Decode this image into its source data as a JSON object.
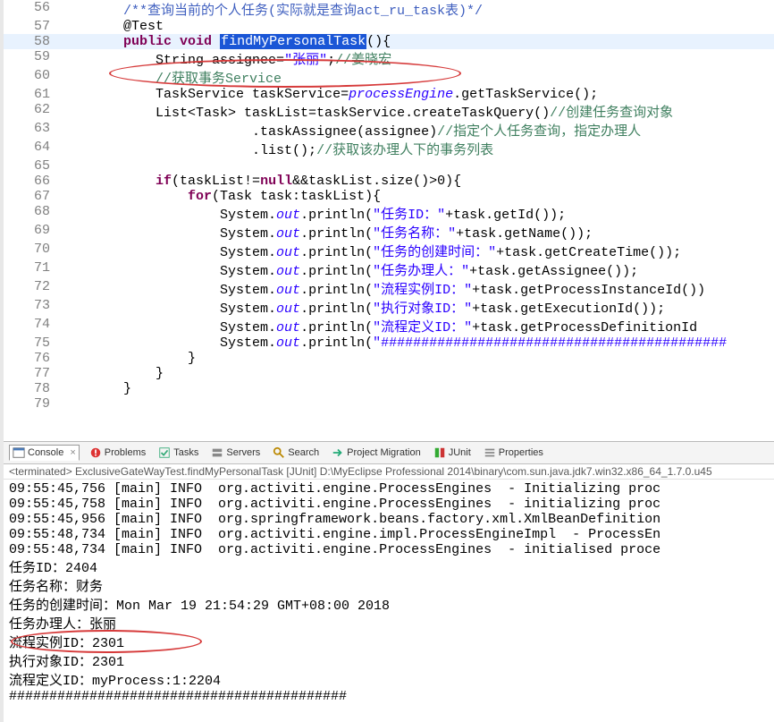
{
  "editor": {
    "lines": [
      {
        "n": 56,
        "segs": [
          {
            "c": "dc",
            "t": "/**查询当前的个人任务(实际就是查询act_ru_task表)*/"
          }
        ],
        "ind": 8
      },
      {
        "n": 57,
        "segs": [
          {
            "t": "@Test"
          }
        ],
        "ind": 8
      },
      {
        "n": 58,
        "segs": [
          {
            "c": "kw",
            "t": "public void"
          },
          {
            "t": " "
          },
          {
            "c": "sel",
            "t": "findMyPersonalTask"
          },
          {
            "t": "(){"
          }
        ],
        "ind": 8,
        "hl": true
      },
      {
        "n": 59,
        "segs": [
          {
            "t": "String assignee="
          },
          {
            "c": "str",
            "t": "\"张丽\""
          },
          {
            "t": ";"
          },
          {
            "c": "cm",
            "t": "//姜晓宏"
          }
        ],
        "ind": 12
      },
      {
        "n": 60,
        "segs": [
          {
            "c": "cm",
            "t": "//获取事务Service"
          }
        ],
        "ind": 12
      },
      {
        "n": 61,
        "segs": [
          {
            "t": "TaskService taskService="
          },
          {
            "c": "it",
            "t": "processEngine"
          },
          {
            "t": ".getTaskService();"
          }
        ],
        "ind": 12
      },
      {
        "n": 62,
        "segs": [
          {
            "t": "List<Task> taskList=taskService.createTaskQuery()"
          },
          {
            "c": "cm",
            "t": "//创建任务查询对象"
          }
        ],
        "ind": 12
      },
      {
        "n": 63,
        "segs": [
          {
            "t": ".taskAssignee(assignee)"
          },
          {
            "c": "cm",
            "t": "//指定个人任务查询，指定办理人"
          }
        ],
        "ind": 24
      },
      {
        "n": 64,
        "segs": [
          {
            "t": ".list();"
          },
          {
            "c": "cm",
            "t": "//获取该办理人下的事务列表"
          }
        ],
        "ind": 24
      },
      {
        "n": 65,
        "segs": [
          {
            "t": ""
          }
        ],
        "ind": 12
      },
      {
        "n": 66,
        "segs": [
          {
            "c": "kw",
            "t": "if"
          },
          {
            "t": "(taskList!="
          },
          {
            "c": "kw",
            "t": "null"
          },
          {
            "t": "&&taskList.size()>0){"
          }
        ],
        "ind": 12
      },
      {
        "n": 67,
        "segs": [
          {
            "c": "kw",
            "t": "for"
          },
          {
            "t": "(Task task:taskList){"
          }
        ],
        "ind": 16
      },
      {
        "n": 68,
        "segs": [
          {
            "t": "System."
          },
          {
            "c": "it",
            "t": "out"
          },
          {
            "t": ".println("
          },
          {
            "c": "str",
            "t": "\"任务ID："
          },
          {
            "c": "str",
            "t": "\""
          },
          {
            "t": "+task.getId());"
          }
        ],
        "ind": 20
      },
      {
        "n": 69,
        "segs": [
          {
            "t": "System."
          },
          {
            "c": "it",
            "t": "out"
          },
          {
            "t": ".println("
          },
          {
            "c": "str",
            "t": "\"任务名称："
          },
          {
            "c": "str",
            "t": "\""
          },
          {
            "t": "+task.getName());"
          }
        ],
        "ind": 20
      },
      {
        "n": 70,
        "segs": [
          {
            "t": "System."
          },
          {
            "c": "it",
            "t": "out"
          },
          {
            "t": ".println("
          },
          {
            "c": "str",
            "t": "\"任务的创建时间："
          },
          {
            "c": "str",
            "t": "\""
          },
          {
            "t": "+task.getCreateTime());"
          }
        ],
        "ind": 20
      },
      {
        "n": 71,
        "segs": [
          {
            "t": "System."
          },
          {
            "c": "it",
            "t": "out"
          },
          {
            "t": ".println("
          },
          {
            "c": "str",
            "t": "\"任务办理人："
          },
          {
            "c": "str",
            "t": "\""
          },
          {
            "t": "+task.getAssignee());"
          }
        ],
        "ind": 20
      },
      {
        "n": 72,
        "segs": [
          {
            "t": "System."
          },
          {
            "c": "it",
            "t": "out"
          },
          {
            "t": ".println("
          },
          {
            "c": "str",
            "t": "\"流程实例ID："
          },
          {
            "c": "str",
            "t": "\""
          },
          {
            "t": "+task.getProcessInstanceId())"
          }
        ],
        "ind": 20
      },
      {
        "n": 73,
        "segs": [
          {
            "t": "System."
          },
          {
            "c": "it",
            "t": "out"
          },
          {
            "t": ".println("
          },
          {
            "c": "str",
            "t": "\"执行对象ID："
          },
          {
            "c": "str",
            "t": "\""
          },
          {
            "t": "+task.getExecutionId());"
          }
        ],
        "ind": 20
      },
      {
        "n": 74,
        "segs": [
          {
            "t": "System."
          },
          {
            "c": "it",
            "t": "out"
          },
          {
            "t": ".println("
          },
          {
            "c": "str",
            "t": "\"流程定义ID："
          },
          {
            "c": "str",
            "t": "\""
          },
          {
            "t": "+task.getProcessDefinitionId"
          }
        ],
        "ind": 20
      },
      {
        "n": 75,
        "segs": [
          {
            "t": "System."
          },
          {
            "c": "it",
            "t": "out"
          },
          {
            "t": ".println("
          },
          {
            "c": "str",
            "t": "\"###########################################"
          }
        ],
        "ind": 20
      },
      {
        "n": 76,
        "segs": [
          {
            "t": "}"
          }
        ],
        "ind": 16
      },
      {
        "n": 77,
        "segs": [
          {
            "t": "}"
          }
        ],
        "ind": 12
      },
      {
        "n": 78,
        "segs": [
          {
            "t": "}"
          }
        ],
        "ind": 8
      },
      {
        "n": 79,
        "segs": [
          {
            "t": ""
          }
        ],
        "ind": 0
      }
    ]
  },
  "views": {
    "tabs": [
      {
        "icon": "console-icon",
        "label": "Console",
        "sel": true
      },
      {
        "icon": "problems-icon",
        "label": "Problems"
      },
      {
        "icon": "tasks-icon",
        "label": "Tasks"
      },
      {
        "icon": "servers-icon",
        "label": "Servers"
      },
      {
        "icon": "search-icon",
        "label": "Search"
      },
      {
        "icon": "migration-icon",
        "label": "Project Migration"
      },
      {
        "icon": "junit-icon",
        "label": "JUnit"
      },
      {
        "icon": "properties-icon",
        "label": "Properties"
      }
    ]
  },
  "status": "<terminated> ExclusiveGateWayTest.findMyPersonalTask [JUnit] D:\\MyEclipse Professional 2014\\binary\\com.sun.java.jdk7.win32.x86_64_1.7.0.u45",
  "console": "09:55:45,756 [main] INFO  org.activiti.engine.ProcessEngines  - Initializing proc\n09:55:45,758 [main] INFO  org.activiti.engine.ProcessEngines  - initializing proc\n09:55:45,956 [main] INFO  org.springframework.beans.factory.xml.XmlBeanDefinition\n09:55:48,734 [main] INFO  org.activiti.engine.impl.ProcessEngineImpl  - ProcessEn\n09:55:48,734 [main] INFO  org.activiti.engine.ProcessEngines  - initialised proce\n任务ID：2404\n任务名称：财务\n任务的创建时间：Mon Mar 19 21:54:29 GMT+08:00 2018\n任务办理人：张丽\n流程实例ID：2301\n执行对象ID：2301\n流程定义ID：myProcess:1:2204\n##########################################"
}
